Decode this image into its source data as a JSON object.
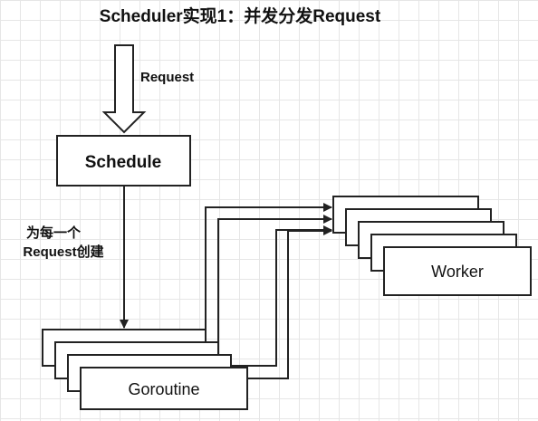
{
  "title": "Scheduler实现1：并发分发Request",
  "labels": {
    "request": "Request",
    "per_request_line1": "为每一个",
    "per_request_line2": "Request创建"
  },
  "nodes": {
    "schedule": "Schedule",
    "goroutine": "Goroutine",
    "worker": "Worker"
  }
}
